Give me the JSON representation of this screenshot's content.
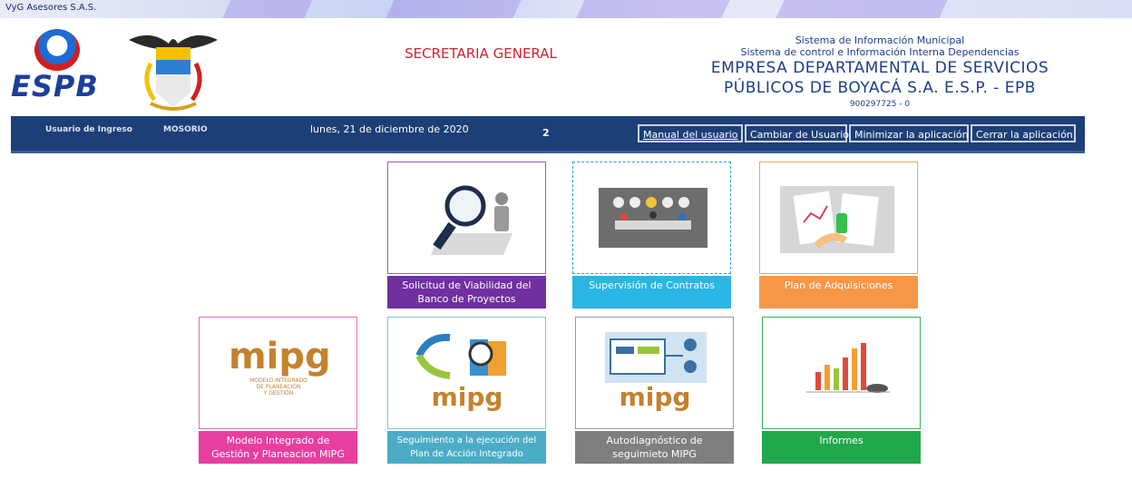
{
  "window": {
    "title": "VyG Asesores S.A.S."
  },
  "header": {
    "logo_text": "ESPB",
    "section_title": "SECRETARIA GENERAL",
    "system_line1": "Sistema de Información Municipal",
    "system_line2": "Sistema de control e Información Interna Dependencias",
    "company_line1": "EMPRESA DEPARTAMENTAL DE SERVICIOS",
    "company_line2": "PÚBLICOS DE BOYACÁ S.A. E.S.P. - EPB",
    "nit": "900297725 - 0"
  },
  "infobar": {
    "user_label": "Usuario de Ingreso",
    "user_value": "MOSORIO",
    "date": "lunes, 21 de diciembre de 2020",
    "count": "2",
    "buttons": {
      "manual": "Manual del usuario",
      "change_user": "Cambiar de Usuario",
      "minimize": "Minimizar la aplicación",
      "close": "Cerrar la aplicación"
    }
  },
  "tiles": [
    {
      "label1": "Solicitud de Viabilidad del",
      "label2": "Banco de Proyectos",
      "color": "#7030a0",
      "border": "#9a5cc8"
    },
    {
      "label1": "Supervisión de Contratos",
      "label2": "",
      "color": "#2ab5e5",
      "border": "#2a9fd0"
    },
    {
      "label1": "Plan de Adquisiciones",
      "label2": "",
      "color": "#f79646",
      "border": "#f5a15c"
    },
    {
      "label1": "Modelo Integrado de",
      "label2": "Gestión y Planeacion MIPG",
      "color": "#e83ea0",
      "border": "#e86cb7"
    },
    {
      "label1": "Seguimiento a la ejecución del",
      "label2": "Plan de Acción Integrado",
      "color": "#4bacc6",
      "border": "#7bc6d8"
    },
    {
      "label1": "Autodiagnóstico de",
      "label2": "seguimieto MIPG",
      "color": "#7f7f7f",
      "border": "#9a9a9a"
    },
    {
      "label1": "Informes",
      "label2": "",
      "color": "#21a84a",
      "border": "#34b060"
    }
  ],
  "mipg": {
    "brand": "mipg",
    "subtitle1": "MODELO INTEGRADO",
    "subtitle2": "DE PLANEACIÓN",
    "subtitle3": "Y GESTIÓN"
  }
}
